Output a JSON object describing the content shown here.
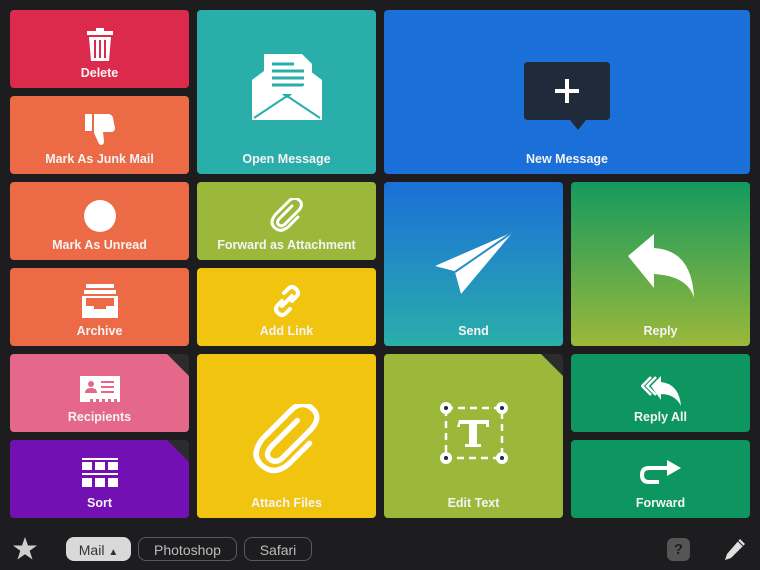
{
  "tiles": {
    "delete": {
      "label": "Delete",
      "color": "#dc2a4c",
      "icon": "trash-icon"
    },
    "junk": {
      "label": "Mark As Junk Mail",
      "color": "#ec6a45",
      "icon": "thumbs-down-icon"
    },
    "unread": {
      "label": "Mark As Unread",
      "color": "#ec6a45",
      "icon": "circle-icon"
    },
    "archive": {
      "label": "Archive",
      "color": "#ec6a45",
      "icon": "archive-tray-icon"
    },
    "recipients": {
      "label": "Recipients",
      "color": "#e5688a",
      "icon": "contact-card-icon"
    },
    "sort": {
      "label": "Sort",
      "color": "#7310b4",
      "icon": "grid-icon"
    },
    "open": {
      "label": "Open Message",
      "color": "#2aaeaa",
      "icon": "open-envelope-icon"
    },
    "fwd_attach": {
      "label": "Forward as Attachment",
      "color": "#9bb83a",
      "icon": "paperclip-icon"
    },
    "add_link": {
      "label": "Add Link",
      "color": "#f1c40f",
      "icon": "link-icon"
    },
    "attach": {
      "label": "Attach Files",
      "color": "#f1c40f",
      "icon": "paperclip-icon"
    },
    "new": {
      "label": "New Message",
      "color": "#1a6fd8",
      "icon": "plus-bubble-icon"
    },
    "send": {
      "label": "Send",
      "color": "#1a6fd8",
      "icon": "paper-plane-icon"
    },
    "reply": {
      "label": "Reply",
      "color": "#149a5e",
      "icon": "reply-arrow-icon"
    },
    "edit_text": {
      "label": "Edit Text",
      "color": "#9bb83a",
      "icon": "text-box-icon"
    },
    "reply_all": {
      "label": "Reply All",
      "color": "#0d9660",
      "icon": "reply-all-icon"
    },
    "forward": {
      "label": "Forward",
      "color": "#0d9660",
      "icon": "forward-arrow-icon"
    }
  },
  "bottom": {
    "tabs": [
      "Mail",
      "Photoshop",
      "Safari"
    ],
    "active_tab": "Mail",
    "help": "?"
  }
}
